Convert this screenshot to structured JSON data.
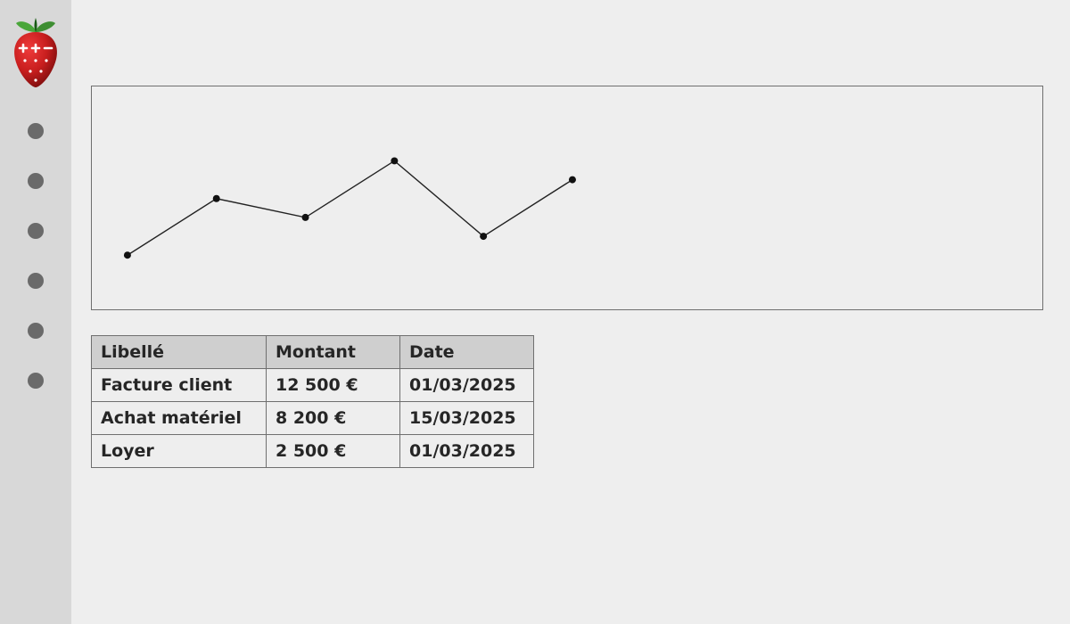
{
  "sidebar": {
    "nav_count": 6
  },
  "chart_data": {
    "type": "line",
    "x": [
      0,
      1,
      2,
      3,
      4,
      5
    ],
    "values": [
      20,
      50,
      40,
      70,
      30,
      60
    ],
    "ylim": [
      0,
      100
    ],
    "title": "",
    "xlabel": "",
    "ylabel": ""
  },
  "table": {
    "headers": [
      "Libellé",
      "Montant",
      "Date"
    ],
    "rows": [
      {
        "libelle": "Facture client",
        "montant": "12 500 €",
        "date": "01/03/2025"
      },
      {
        "libelle": "Achat matériel",
        "montant": "8 200 €",
        "date": "15/03/2025"
      },
      {
        "libelle": "Loyer",
        "montant": "2 500 €",
        "date": "01/03/2025"
      }
    ]
  }
}
